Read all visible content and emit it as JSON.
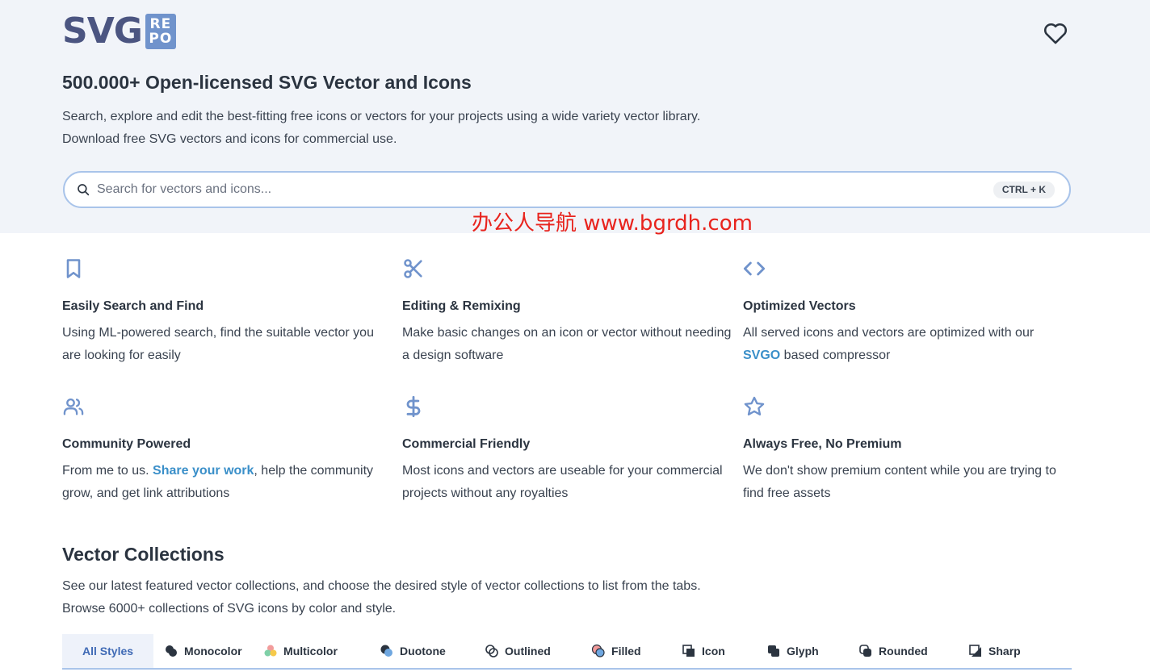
{
  "header": {
    "logo_main": "SVG",
    "logo_badge_line1": "RE",
    "logo_badge_line2": "PO"
  },
  "hero": {
    "title": "500.000+ Open-licensed SVG Vector and Icons",
    "desc_line1": "Search, explore and edit the best-fitting free icons or vectors for your projects using a wide variety vector library.",
    "desc_line2": "Download free SVG vectors and icons for commercial use."
  },
  "search": {
    "placeholder": "Search for vectors and icons...",
    "shortcut": "CTRL + K"
  },
  "watermark": "办公人导航  www.bgrdh.com",
  "features": [
    {
      "icon": "bookmark-icon",
      "title": "Easily Search and Find",
      "desc": "Using ML-powered search, find the suitable vector you are looking for easily"
    },
    {
      "icon": "scissors-icon",
      "title": "Editing & Remixing",
      "desc": "Make basic changes on an icon or vector without needing a design software"
    },
    {
      "icon": "code-icon",
      "title": "Optimized Vectors",
      "desc_before": "All served icons and vectors are optimized with our ",
      "link": "SVGO",
      "desc_after": " based compressor"
    },
    {
      "icon": "users-icon",
      "title": "Community Powered",
      "desc_before": "From me to us. ",
      "link": "Share your work",
      "desc_after": ", help the community grow, and get link attributions"
    },
    {
      "icon": "dollar-icon",
      "title": "Commercial Friendly",
      "desc": "Most icons and vectors are useable for your commercial projects without any royalties"
    },
    {
      "icon": "star-icon",
      "title": "Always Free, No Premium",
      "desc": "We don't show premium content while you are trying to find free assets"
    }
  ],
  "collections": {
    "title": "Vector Collections",
    "desc_line1": "See our latest featured vector collections, and choose the desired style of vector collections to list from the tabs.",
    "desc_line2": "Browse 6000+ collections of SVG icons by color and style.",
    "tabs": [
      "All Styles",
      "Monocolor",
      "Multicolor",
      "Duotone",
      "Outlined",
      "Filled",
      "Icon",
      "Glyph",
      "Rounded",
      "Sharp"
    ],
    "active_tab": "All Styles"
  },
  "colors": {
    "accent": "#7093cc",
    "link": "#3a8fc9",
    "hero_bg": "#f1f4f9",
    "watermark": "#e8231d"
  }
}
